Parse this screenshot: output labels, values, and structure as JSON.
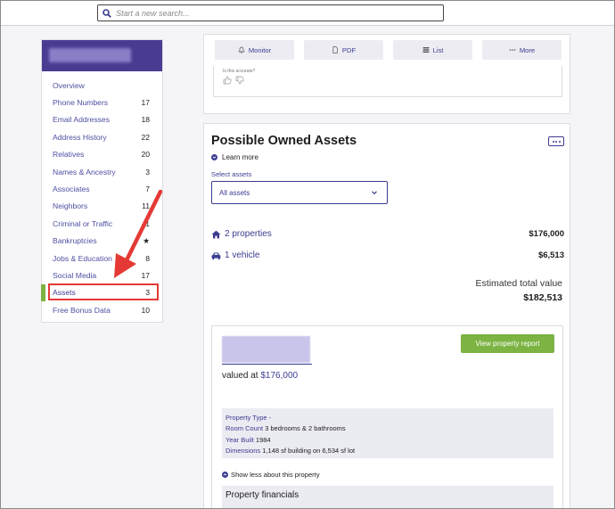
{
  "search": {
    "placeholder": "Start a new search..."
  },
  "sidebar": {
    "items": [
      {
        "label": "Overview",
        "count": ""
      },
      {
        "label": "Phone Numbers",
        "count": "17"
      },
      {
        "label": "Email Addresses",
        "count": "18"
      },
      {
        "label": "Address History",
        "count": "22"
      },
      {
        "label": "Relatives",
        "count": "20"
      },
      {
        "label": "Names & Ancestry",
        "count": "3"
      },
      {
        "label": "Associates",
        "count": "7"
      },
      {
        "label": "Neighbors",
        "count": "11"
      },
      {
        "label": "Criminal or Traffic",
        "count": "1"
      },
      {
        "label": "Bankruptcies",
        "count": "★"
      },
      {
        "label": "Jobs & Education",
        "count": "8"
      },
      {
        "label": "Social Media",
        "count": "17"
      },
      {
        "label": "Assets",
        "count": "3"
      },
      {
        "label": "Free Bonus Data",
        "count": "10"
      }
    ],
    "active": "Assets"
  },
  "toolbar": {
    "monitor": "Monitor",
    "pdf": "PDF",
    "list": "List",
    "more": "More"
  },
  "feedback": {
    "question": "Is this accurate?"
  },
  "assets": {
    "title": "Possible Owned Assets",
    "learn_more": "Learn more",
    "select_label": "Select assets",
    "select_value": "All assets",
    "properties_label": "2 properties",
    "properties_value": "$176,000",
    "vehicles_label": "1 vehicle",
    "vehicles_value": "$6,513",
    "estimated_label": "Estimated total value",
    "estimated_value": "$182,513"
  },
  "property": {
    "valued_prefix": "valued at",
    "valued_amount": "$176,000",
    "view_button": "View property report",
    "type_label": "Property Type -",
    "room_label": "Room Count",
    "room_value": "3 bedrooms & 2 bathrooms",
    "year_label": "Year Built",
    "year_value": "1984",
    "dim_label": "Dimensions",
    "dim_value": "1,148 sf building on 6,534 sf lot",
    "show_less": "Show less about this property",
    "financials": "Property financials"
  },
  "colors": {
    "brand": "#4a3b92",
    "accent_green": "#7cb342",
    "annotation_red": "#e53935",
    "link": "#3b3c90"
  }
}
